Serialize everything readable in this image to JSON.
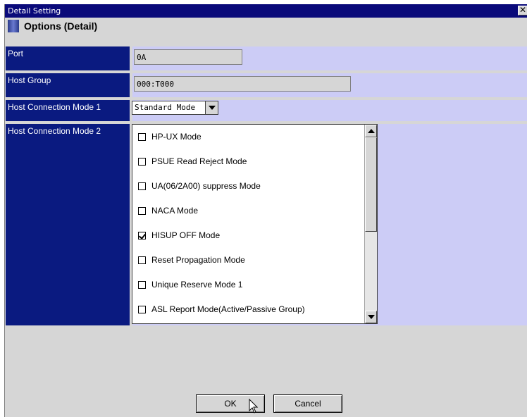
{
  "window": {
    "title": "Detail Setting",
    "close_glyph": "✕"
  },
  "section": {
    "title": "Options (Detail)",
    "icon": "panel-icon"
  },
  "fields": {
    "port": {
      "label": "Port",
      "value": "0A"
    },
    "host_group": {
      "label": "Host Group",
      "value": "000:T000"
    },
    "host_mode_1": {
      "label": "Host Connection Mode 1",
      "selected": "Standard Mode"
    },
    "host_mode_2": {
      "label": "Host Connection Mode 2",
      "options": [
        {
          "label": "HP-UX Mode",
          "checked": false
        },
        {
          "label": "PSUE Read Reject Mode",
          "checked": false
        },
        {
          "label": "UA(06/2A00) suppress Mode",
          "checked": false
        },
        {
          "label": "NACA Mode",
          "checked": false
        },
        {
          "label": "HISUP OFF Mode",
          "checked": true
        },
        {
          "label": "Reset Propagation Mode",
          "checked": false
        },
        {
          "label": "Unique Reserve Mode 1",
          "checked": false
        },
        {
          "label": "ASL Report Mode(Active/Passive Group)",
          "checked": false
        }
      ]
    }
  },
  "buttons": {
    "ok": "OK",
    "cancel": "Cancel"
  },
  "colors": {
    "title_bar": "#0a0a7a",
    "label_bg": "#0a1a80",
    "value_bg": "#ccccf6",
    "window_bg": "#d6d6d6"
  }
}
